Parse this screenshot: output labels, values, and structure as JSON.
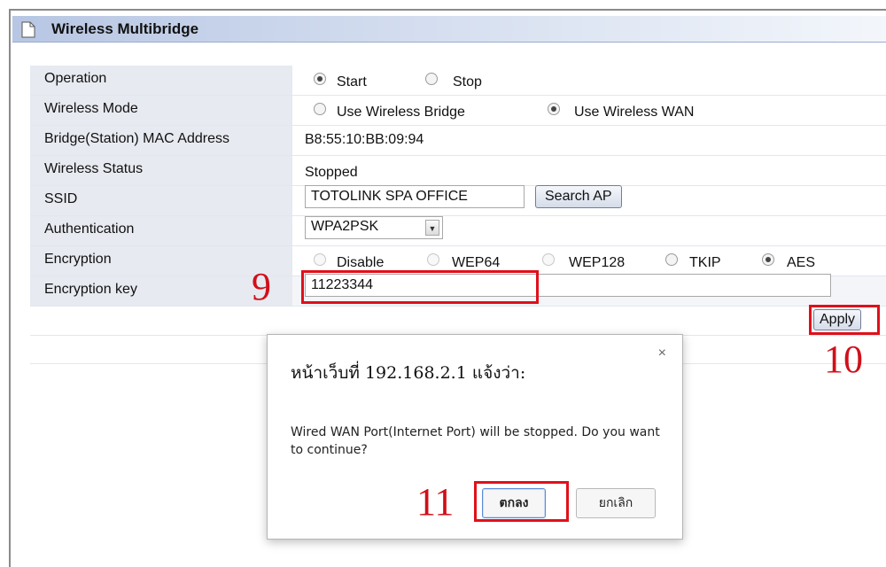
{
  "header": {
    "title": "Wireless Multibridge",
    "icon": "page-icon"
  },
  "form": {
    "operation": {
      "label": "Operation",
      "options": [
        "Start",
        "Stop"
      ],
      "selected": "Start"
    },
    "wireless_mode": {
      "label": "Wireless Mode",
      "options": [
        "Use Wireless Bridge",
        "Use Wireless WAN"
      ],
      "selected": "Use Wireless WAN"
    },
    "mac": {
      "label": "Bridge(Station) MAC Address",
      "value": "B8:55:10:BB:09:94"
    },
    "status": {
      "label": "Wireless Status",
      "value": "Stopped"
    },
    "ssid": {
      "label": "SSID",
      "value": "TOTOLINK SPA OFFICE",
      "button": "Search AP"
    },
    "authentication": {
      "label": "Authentication",
      "value": "WPA2PSK"
    },
    "encryption": {
      "label": "Encryption",
      "options": [
        "Disable",
        "WEP64",
        "WEP128",
        "TKIP",
        "AES"
      ],
      "selected": "AES",
      "disabled": [
        "Disable",
        "WEP64",
        "WEP128"
      ]
    },
    "encryption_key": {
      "label": "Encryption key",
      "value": "11223344"
    },
    "apply_label": "Apply"
  },
  "annotations": {
    "step9": "9",
    "step10": "10",
    "step11": "11",
    "color": "#e0101a"
  },
  "dialog": {
    "title": "หน้าเว็บที่ 192.168.2.1 แจ้งว่า:",
    "message": "Wired WAN Port(Internet Port) will be stopped. Do you want to continue?",
    "ok_label": "ตกลง",
    "cancel_label": "ยกเลิก",
    "close_icon": "×"
  }
}
